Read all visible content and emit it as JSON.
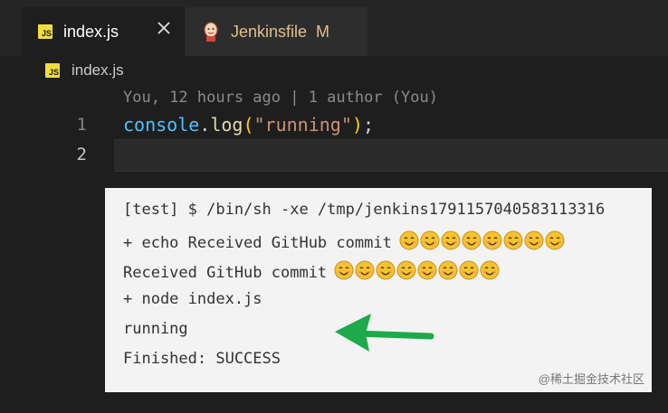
{
  "tabs": [
    {
      "label": "index.js",
      "icon": "js-file-icon",
      "active": true,
      "close": "✕"
    },
    {
      "label": "Jenkinsfile",
      "icon": "jenkins-icon",
      "active": false,
      "status": "M"
    }
  ],
  "breadcrumb": {
    "icon": "js-file-icon",
    "label": "index.js"
  },
  "editor": {
    "blame": "You, 12 hours ago | 1 author (You)",
    "line_numbers": [
      "1",
      "2"
    ],
    "code": {
      "object": "console",
      "dot": ".",
      "method": "log",
      "open_paren": "(",
      "string": "\"running\"",
      "close_paren": ")",
      "semicolon": ";"
    }
  },
  "console": {
    "lines": [
      "[test] $ /bin/sh -xe /tmp/jenkins1791157040583113316",
      "+ echo Received GitHub commit",
      "Received GitHub commit",
      "+ node index.js",
      "running",
      "Finished: SUCCESS"
    ],
    "emoji_count": 8,
    "emoji": "smiley-face-icon"
  },
  "watermark": "@稀土掘金技术社区",
  "colors": {
    "js_badge": "#f1dd3f",
    "modified_tab": "#e2c08d",
    "arrow": "#1faa4a",
    "emoji": "#f5c330"
  }
}
